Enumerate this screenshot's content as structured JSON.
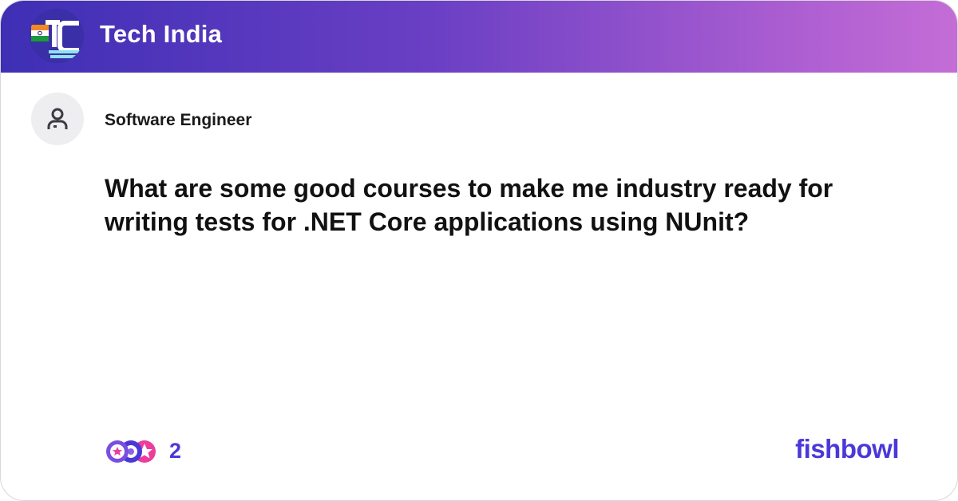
{
  "header": {
    "group_name": "Tech India",
    "logo_icon": "tech-india-logo-icon",
    "colors": {
      "gradient_start": "#3e2fb5",
      "gradient_end": "#c46dd6"
    }
  },
  "post": {
    "author_avatar_icon": "user-avatar-icon",
    "author_title": "Software Engineer",
    "question": "What are some good courses to make me industry ready for writing tests for .NET Core applications using NUnit?"
  },
  "footer": {
    "reactions_icon": "reaction-stack-icon",
    "reaction_count": "2",
    "brand": "fishbowl",
    "brand_color": "#4a38d9"
  }
}
